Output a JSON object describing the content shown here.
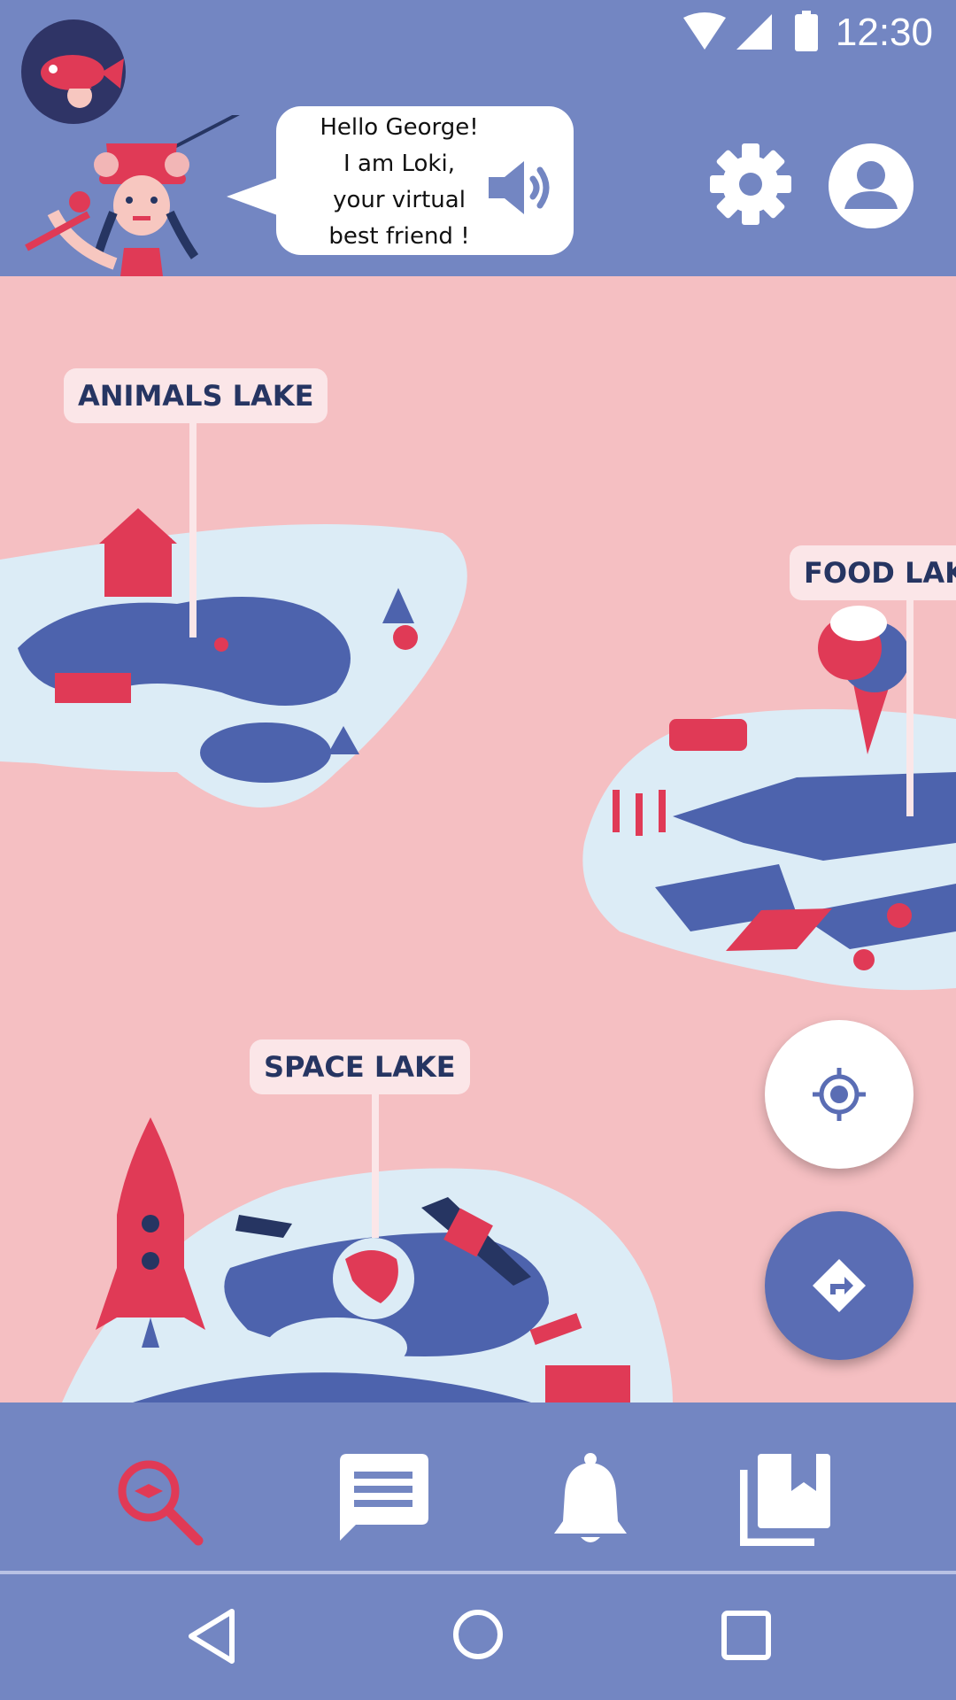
{
  "status_bar": {
    "time": "12:30",
    "icons": [
      "wifi-icon",
      "signal-icon",
      "battery-icon"
    ]
  },
  "header": {
    "avatar": "fish-avatar-icon",
    "greeting_lines": [
      "Hello George!",
      "I am Loki,",
      "your virtual",
      "best friend !"
    ],
    "speaker_icon": "speaker-icon",
    "settings_icon": "gear-icon",
    "profile_icon": "profile-icon"
  },
  "map": {
    "lakes": [
      {
        "label": "ANIMALS LAKE"
      },
      {
        "label": "FOOD LAKE"
      },
      {
        "label": "SPACE LAKE"
      }
    ],
    "fab_locate_icon": "locate-icon",
    "fab_directions_icon": "directions-icon"
  },
  "bottom_nav": {
    "items": [
      {
        "icon": "explore-search-icon",
        "active": true
      },
      {
        "icon": "chat-icon",
        "active": false
      },
      {
        "icon": "bell-icon",
        "active": false
      },
      {
        "icon": "library-icon",
        "active": false
      }
    ]
  },
  "system_nav": [
    "back-icon",
    "home-icon",
    "recents-icon"
  ],
  "colors": {
    "header": "#7386c2",
    "map_bg": "#f5bfc2",
    "accent": "#e03a56",
    "island": "#dcecf6",
    "water": "#4d63ad"
  }
}
